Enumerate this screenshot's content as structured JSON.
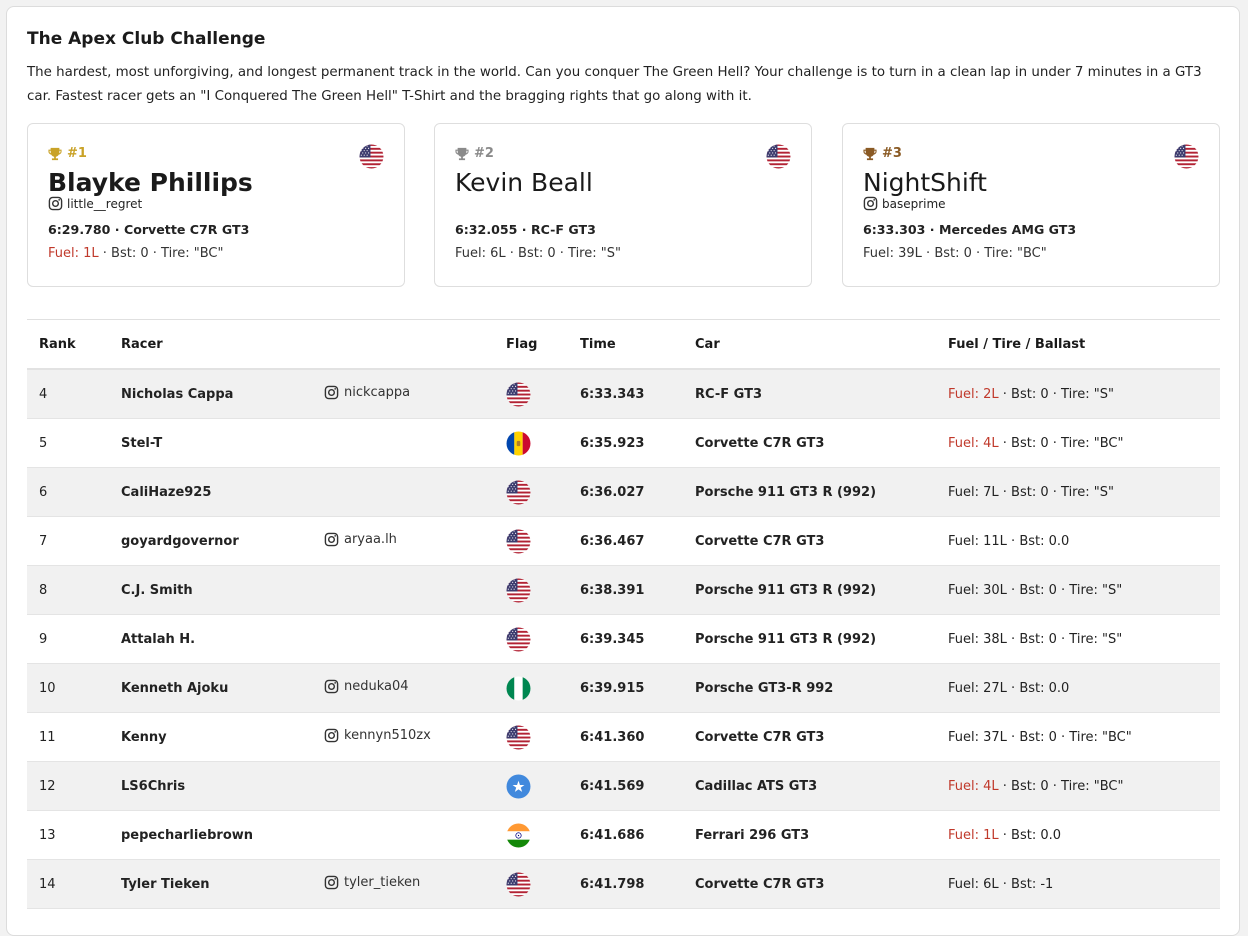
{
  "challenge": {
    "title": "The Apex Club Challenge",
    "description": "The hardest, most unforgiving, and longest permanent track in the world. Can you conquer The Green Hell? Your challenge is to turn in a clean lap in under 7 minutes in a GT3 car. Fastest racer gets an \"I Conquered The Green Hell\" T-Shirt and the bragging rights that go along with it."
  },
  "podium": [
    {
      "rank": "#1",
      "name": "Blayke Phillips",
      "instagram": "little__regret",
      "time_car": "6:29.780 · Corvette C7R GT3",
      "fuel": "Fuel: 1L",
      "fuel_warning": true,
      "rest": " · Bst: 0 · Tire: \"BC\"",
      "flag": "us"
    },
    {
      "rank": "#2",
      "name": "Kevin Beall",
      "instagram": "",
      "time_car": "6:32.055 · RC-F GT3",
      "fuel": "Fuel: 6L",
      "fuel_warning": false,
      "rest": " · Bst: 0 · Tire: \"S\"",
      "flag": "us"
    },
    {
      "rank": "#3",
      "name": "NightShift",
      "instagram": "baseprime",
      "time_car": "6:33.303 · Mercedes AMG GT3",
      "fuel": "Fuel: 39L",
      "fuel_warning": false,
      "rest": " · Bst: 0 · Tire: \"BC\"",
      "flag": "us"
    }
  ],
  "table": {
    "headers": {
      "rank": "Rank",
      "racer": "Racer",
      "flag": "Flag",
      "time": "Time",
      "car": "Car",
      "setup": "Fuel / Tire / Ballast"
    },
    "rows": [
      {
        "rank": "4",
        "racer": "Nicholas Cappa",
        "instagram": "nickcappa",
        "flag": "us",
        "time": "6:33.343",
        "car": "RC-F GT3",
        "fuel": "Fuel: 2L",
        "fuel_warning": true,
        "rest": " · Bst: 0 · Tire: \"S\""
      },
      {
        "rank": "5",
        "racer": "Stel-T",
        "instagram": "",
        "flag": "md",
        "time": "6:35.923",
        "car": "Corvette C7R GT3",
        "fuel": "Fuel: 4L",
        "fuel_warning": true,
        "rest": " · Bst: 0 · Tire: \"BC\""
      },
      {
        "rank": "6",
        "racer": "CaliHaze925",
        "instagram": "",
        "flag": "us",
        "time": "6:36.027",
        "car": "Porsche 911 GT3 R (992)",
        "fuel": "Fuel: 7L",
        "fuel_warning": false,
        "rest": " · Bst: 0 · Tire: \"S\""
      },
      {
        "rank": "7",
        "racer": "goyardgovernor",
        "instagram": "aryaa.lh",
        "flag": "us",
        "time": "6:36.467",
        "car": "Corvette C7R GT3",
        "fuel": "Fuel: 11L",
        "fuel_warning": false,
        "rest": " · Bst: 0.0"
      },
      {
        "rank": "8",
        "racer": "C.J. Smith",
        "instagram": "",
        "flag": "us",
        "time": "6:38.391",
        "car": "Porsche 911 GT3 R (992)",
        "fuel": "Fuel: 30L",
        "fuel_warning": false,
        "rest": " · Bst: 0 · Tire: \"S\""
      },
      {
        "rank": "9",
        "racer": "Attalah H.",
        "instagram": "",
        "flag": "us",
        "time": "6:39.345",
        "car": "Porsche 911 GT3 R (992)",
        "fuel": "Fuel: 38L",
        "fuel_warning": false,
        "rest": " · Bst: 0 · Tire: \"S\""
      },
      {
        "rank": "10",
        "racer": "Kenneth Ajoku",
        "instagram": "neduka04",
        "flag": "ng",
        "time": "6:39.915",
        "car": "Porsche GT3-R 992",
        "fuel": "Fuel: 27L",
        "fuel_warning": false,
        "rest": " · Bst: 0.0"
      },
      {
        "rank": "11",
        "racer": "Kenny",
        "instagram": "kennyn510zx",
        "flag": "us",
        "time": "6:41.360",
        "car": "Corvette C7R GT3",
        "fuel": "Fuel: 37L",
        "fuel_warning": false,
        "rest": " · Bst: 0 · Tire: \"BC\""
      },
      {
        "rank": "12",
        "racer": "LS6Chris",
        "instagram": "",
        "flag": "so",
        "time": "6:41.569",
        "car": "Cadillac ATS GT3",
        "fuel": "Fuel: 4L",
        "fuel_warning": true,
        "rest": " · Bst: 0 · Tire: \"BC\""
      },
      {
        "rank": "13",
        "racer": "pepecharliebrown",
        "instagram": "",
        "flag": "in",
        "time": "6:41.686",
        "car": "Ferrari 296 GT3",
        "fuel": "Fuel: 1L",
        "fuel_warning": true,
        "rest": " · Bst: 0.0"
      },
      {
        "rank": "14",
        "racer": "Tyler Tieken",
        "instagram": "tyler_tieken",
        "flag": "us",
        "time": "6:41.798",
        "car": "Corvette C7R GT3",
        "fuel": "Fuel: 6L",
        "fuel_warning": false,
        "rest": " · Bst: -1"
      }
    ]
  },
  "colors": {
    "gold": "#c9a227",
    "silver": "#8a8a8a",
    "bronze": "#8a5a24",
    "warning": "#c0392b"
  }
}
